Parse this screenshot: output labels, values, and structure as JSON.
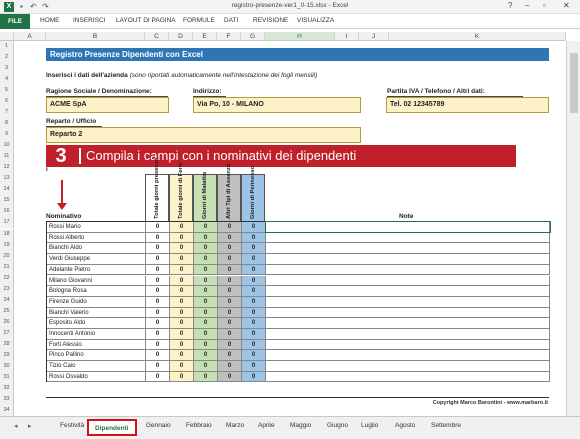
{
  "window": {
    "title": "registro-presenze-ver1_0-15.xlsx - Excel",
    "excel_icon": "X",
    "undo_icon": "↶",
    "redo_icon": "↷",
    "help_icon": "?",
    "minimize_icon": "–",
    "restore_icon": "▫",
    "close_icon": "✕"
  },
  "ribbon": {
    "file": "FILE",
    "tabs": [
      "HOME",
      "INSERISCI",
      "LAYOUT DI PAGINA",
      "FORMULE",
      "DATI",
      "REVISIONE",
      "VISUALIZZA"
    ]
  },
  "columns": [
    "A",
    "B",
    "C",
    "D",
    "E",
    "F",
    "G",
    "H",
    "I",
    "J",
    "K"
  ],
  "rows": [
    "1",
    "2",
    "3",
    "4",
    "5",
    "6",
    "7",
    "8",
    "9",
    "10",
    "11",
    "12",
    "13",
    "14",
    "15",
    "16",
    "17",
    "18",
    "19",
    "20",
    "21",
    "22",
    "23",
    "24",
    "25",
    "26",
    "27",
    "28",
    "29",
    "30",
    "31",
    "32",
    "33",
    "34"
  ],
  "sheet": {
    "title": "Registro Presenze Dipendenti con Excel",
    "intro_bold": "Inserisci i dati dell'azienda",
    "intro_italic": "(sono riportati automaticamente nell'intestazione dei fogli mensili)",
    "label_ragione": "Ragione Sociale / Denominazione:",
    "label_indirizzo": "Indirizzo:",
    "label_partita": "Partita IVA / Telefono / Altri dati:",
    "value_ragione": "ACME SpA",
    "value_indirizzo": "Via Po, 10 - MILANO",
    "value_partita": "Tel. 02 12345789",
    "label_reparto": "Reparto / Ufficio",
    "value_reparto": "Reparto 2",
    "row11_partial": "I",
    "row12_partial": "n",
    "row13_partial": "i",
    "col_nominativo": "Nominativo",
    "col_note": "Note",
    "vheaders": [
      "Totale giorni presenza",
      "Totale giorni di Ferie",
      "Giorni di Malattia",
      "Altri Tipi di Assenza",
      "Giorni di Permesso"
    ],
    "vheader_colors": [
      "#ffffff",
      "#fdf2c7",
      "#c6e0b4",
      "#bfbfbf",
      "#9dc3e6"
    ],
    "employees": [
      "Rossi Mario",
      "Rossi Alberto",
      "Bianchi Aldo",
      "Verdi Giuseppe",
      "Adelante Pietro",
      "Milano Giovanni",
      "Bologna Rosa",
      "Firenze Guido",
      "Bianchi Valerio",
      "Esposito Aldo",
      "Innocenti Antonio",
      "Forti Alessio",
      "Pinco Pallino",
      "Tizio Caio",
      "Rossi Osvaldo"
    ],
    "zero": "0",
    "copyright": "Copyright Marco Barontini - www.marbaro.it"
  },
  "callout": {
    "number": "3",
    "text": "Compila i campi con i nominativi dei dipendenti",
    "color": "#c0202a"
  },
  "sheet_tabs": {
    "nav_prev": "◂",
    "nav_next": "▸",
    "tabs": [
      "Festività",
      "Dipendenti",
      "Gennaio",
      "Febbraio",
      "Marzo",
      "Aprile",
      "Maggio",
      "Giugno",
      "Luglio",
      "Agosto",
      "Settembre"
    ],
    "active": "Dipendenti"
  }
}
